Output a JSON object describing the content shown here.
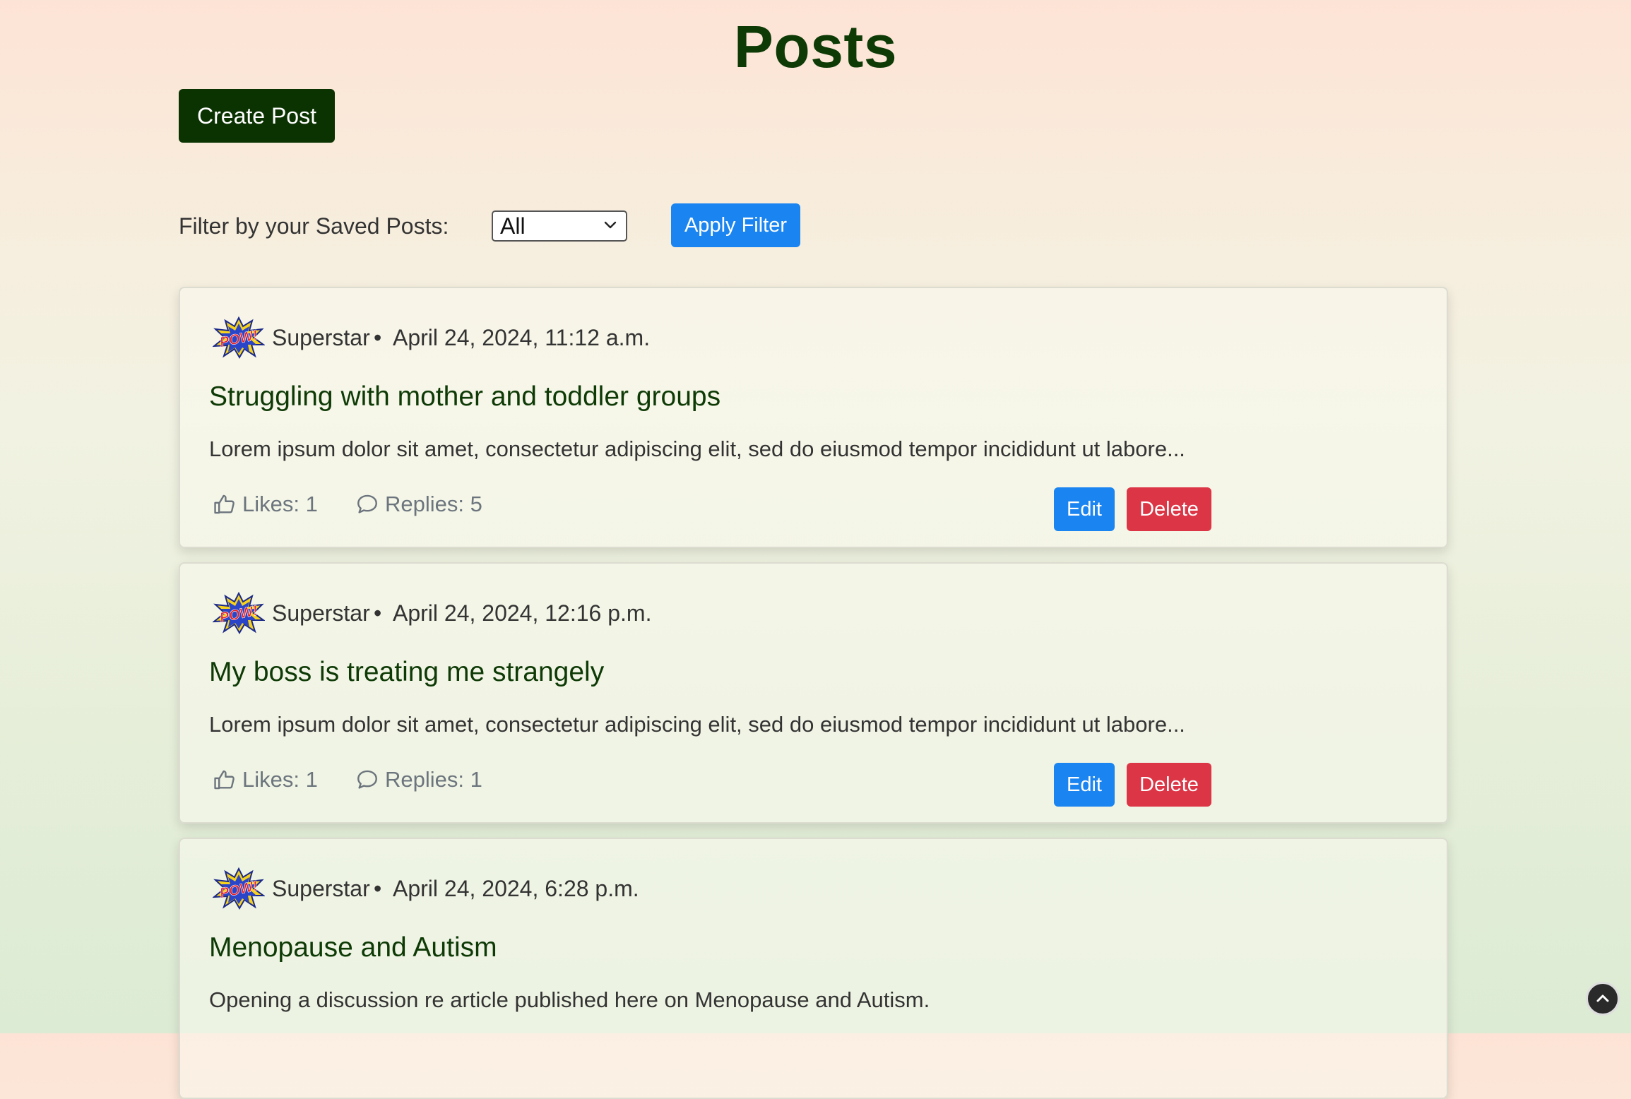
{
  "header": {
    "title": "Posts",
    "create_button_label": "Create Post"
  },
  "filter": {
    "label": "Filter by your Saved Posts:",
    "selected": "All",
    "apply_label": "Apply Filter"
  },
  "posts": [
    {
      "author": "Superstar",
      "separator": "•",
      "date": "April 24, 2024, 11:12 a.m.",
      "title": "Struggling with mother and toddler groups",
      "excerpt": "Lorem ipsum dolor sit amet, consectetur adipiscing elit, sed do eiusmod tempor incididunt ut labore...",
      "likes": "Likes: 1",
      "replies": "Replies: 5",
      "edit_label": "Edit",
      "delete_label": "Delete"
    },
    {
      "author": "Superstar",
      "separator": "•",
      "date": "April 24, 2024, 12:16 p.m.",
      "title": "My boss is treating me strangely",
      "excerpt": "Lorem ipsum dolor sit amet, consectetur adipiscing elit, sed do eiusmod tempor incididunt ut labore...",
      "likes": "Likes: 1",
      "replies": "Replies: 1",
      "edit_label": "Edit",
      "delete_label": "Delete"
    },
    {
      "author": "Superstar",
      "separator": "•",
      "date": "April 24, 2024, 6:28 p.m.",
      "title": "Menopause and Autism",
      "excerpt": "Opening a discussion re article published here on Menopause and Autism."
    }
  ],
  "icons": {
    "avatar": "pow-comic-avatar",
    "likes": "thumbs-up-icon",
    "replies": "chat-bubble-icon",
    "select": "chevron-down-icon",
    "scroll_top": "chevron-up-icon"
  },
  "colors": {
    "title": "#0e3a06",
    "create_button": "#0b3302",
    "primary": "#1a84f0",
    "danger": "#dc3545",
    "muted": "#6c757d"
  }
}
